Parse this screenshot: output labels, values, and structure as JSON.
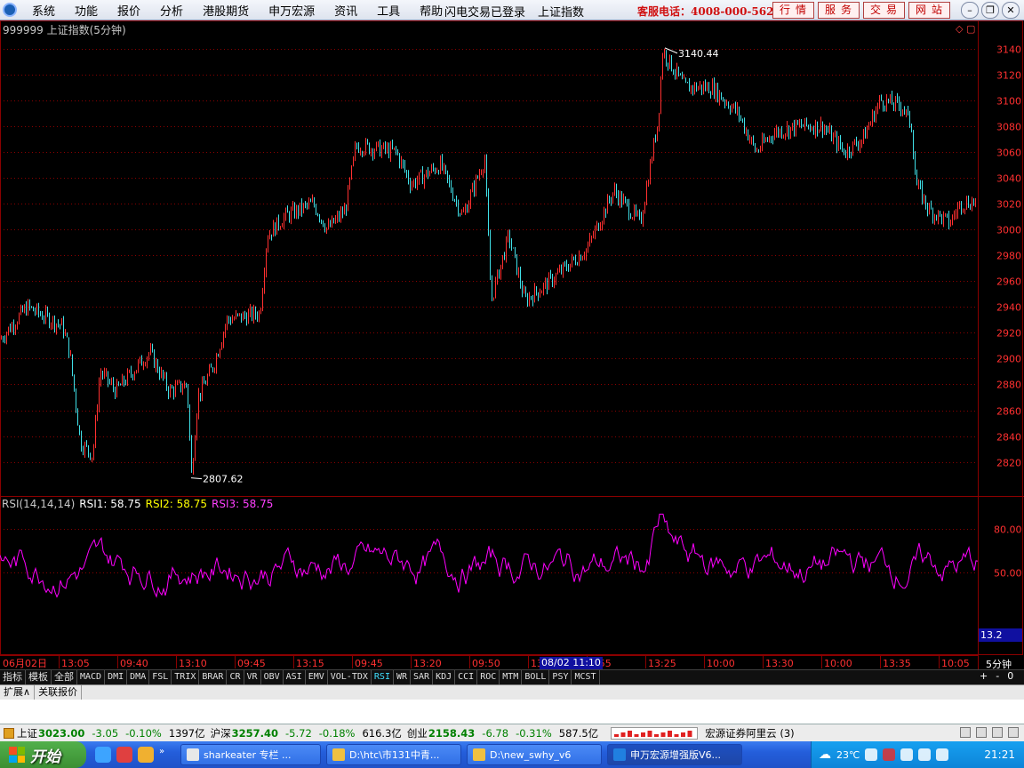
{
  "menubar": {
    "items": [
      "系统",
      "功能",
      "报价",
      "分析",
      "港股期货",
      "申万宏源",
      "资讯",
      "工具",
      "帮助"
    ],
    "status": "闪电交易已登录",
    "index_name": "上证指数",
    "hotline": "客服电话：4008-000-562",
    "quick_buttons": [
      "行情",
      "服务",
      "交易",
      "网站"
    ]
  },
  "main_chart": {
    "title": "999999 上证指数(5分钟)",
    "high_label": "3140.44",
    "low_label": "2807.62",
    "y_ticks": [
      2820,
      2840,
      2860,
      2880,
      2900,
      2920,
      2940,
      2960,
      2980,
      3000,
      3020,
      3040,
      3060,
      3080,
      3100,
      3120,
      3140
    ],
    "ylim": [
      2795,
      3150
    ]
  },
  "indicator": {
    "name": "RSI(14,14,14)",
    "rsi1_label": "RSI1:",
    "rsi1_value": "58.75",
    "rsi2_label": "RSI2:",
    "rsi2_value": "58.75",
    "rsi3_label": "RSI3:",
    "rsi3_value": "58.75",
    "y_ticks": [
      "80.00",
      "50.00"
    ],
    "cursor_value": "13.2"
  },
  "time_axis": {
    "labels": [
      "06月02日",
      "13:05",
      "09:40",
      "13:10",
      "09:45",
      "13:15",
      "09:45",
      "13:20",
      "09:50",
      "13",
      "1:55",
      "13:25",
      "10:00",
      "13:30",
      "10:00",
      "13:35",
      "10:05"
    ],
    "cursor_time": "08/02 11:10",
    "period": "5分钟"
  },
  "indicator_tabs": [
    "指标",
    "模板",
    "全部",
    "MACD",
    "DMI",
    "DMA",
    "FSL",
    "TRIX",
    "BRAR",
    "CR",
    "VR",
    "OBV",
    "ASI",
    "EMV",
    "VOL-TDX",
    "RSI",
    "WR",
    "SAR",
    "KDJ",
    "CCI",
    "ROC",
    "MTM",
    "BOLL",
    "PSY",
    "MCST"
  ],
  "active_tab": "RSI",
  "zoom": {
    "plus": "+",
    "minus": "-",
    "zero": "0"
  },
  "ext_tabs": [
    "扩展∧",
    "关联报价"
  ],
  "ticker": {
    "sh_name": "上证",
    "sh_value": "3023.00",
    "sh_chg": "-3.05",
    "sh_pct": "-0.10%",
    "sh_amt": "1397亿",
    "hs_name": "沪深",
    "hs_value": "3257.40",
    "hs_chg": "-5.72",
    "hs_pct": "-0.18%",
    "hs_amt": "616.3亿",
    "cy_name": "创业",
    "cy_value": "2158.43",
    "cy_chg": "-6.78",
    "cy_pct": "-0.31%",
    "cy_amt": "587.5亿",
    "broker": "宏源证券阿里云 (3)"
  },
  "taskbar": {
    "start": "开始",
    "tasks": [
      "sharkeater 专栏 ...",
      "D:\\htc\\市131中青...",
      "D:\\new_swhy_v6",
      "申万宏源增强版V6..."
    ],
    "temperature": "23℃",
    "clock": "21:21"
  },
  "colors": {
    "up": "#ff3030",
    "down": "#40e0e8",
    "rsi": "#ff00ff",
    "grid": "#8b0000",
    "axis_text": "#ff3030"
  }
}
